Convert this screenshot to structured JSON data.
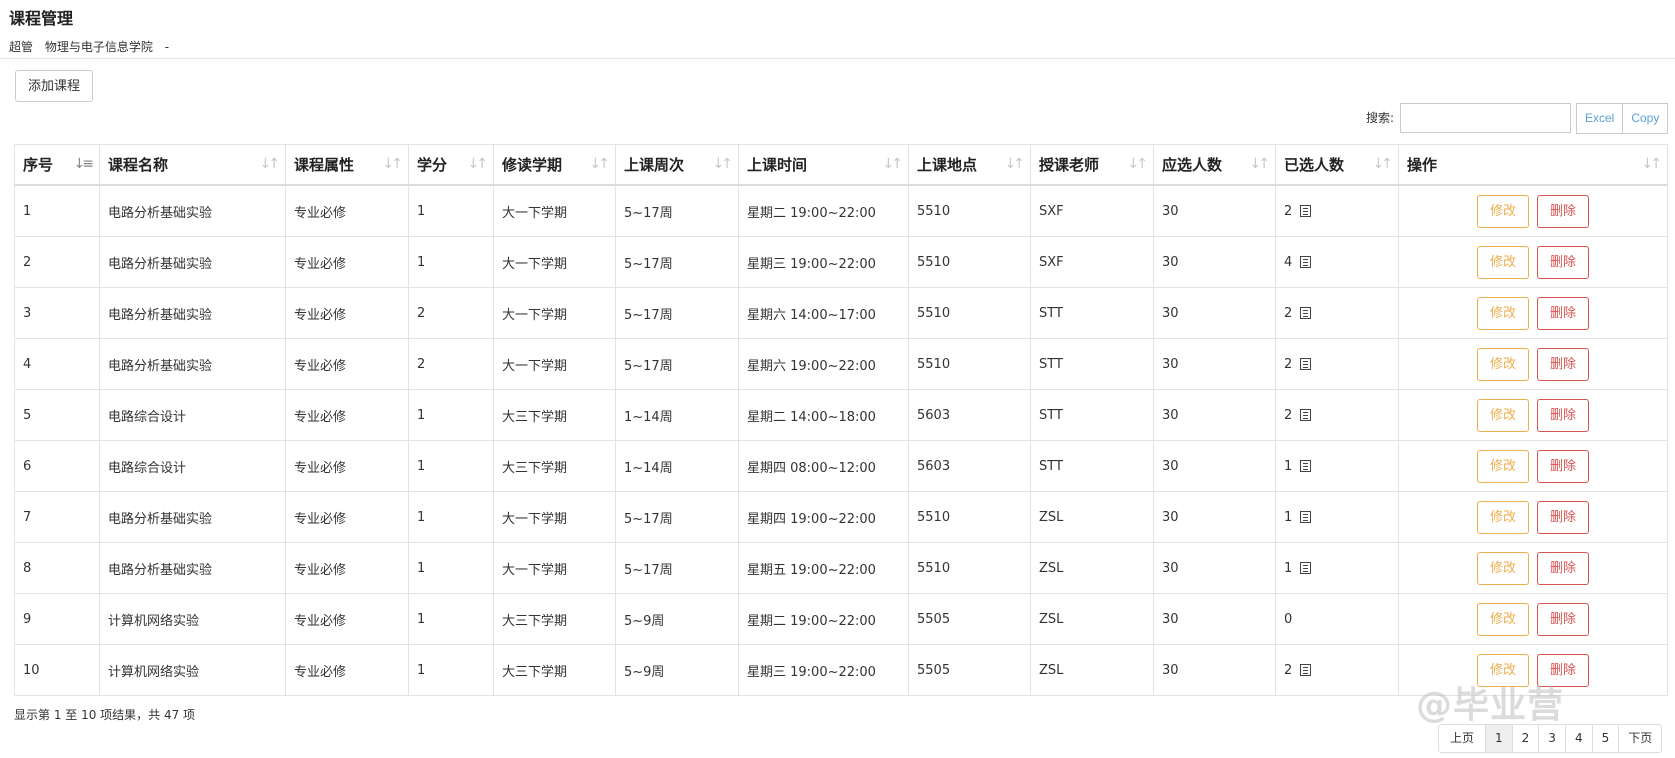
{
  "page": {
    "title": "课程管理",
    "user_role": "超管",
    "department": "物理与电子信息学院",
    "sep": "-"
  },
  "toolbar": {
    "add_course_label": "添加课程"
  },
  "search": {
    "label": "搜索:",
    "value": ""
  },
  "export": {
    "excel_label": "Excel",
    "copy_label": "Copy"
  },
  "table": {
    "columns": [
      "序号",
      "课程名称",
      "课程属性",
      "学分",
      "修读学期",
      "上课周次",
      "上课时间",
      "上课地点",
      "授课老师",
      "应选人数",
      "已选人数",
      "操作"
    ],
    "rows": [
      {
        "no": "1",
        "name": "电路分析基础实验",
        "type": "专业必修",
        "credit": "1",
        "term": "大一下学期",
        "weeks": "5~17周",
        "time": "星期二 19:00~22:00",
        "room": "5510",
        "teacher": "SXF",
        "cap": "30",
        "sel": "2",
        "has_list": true
      },
      {
        "no": "2",
        "name": "电路分析基础实验",
        "type": "专业必修",
        "credit": "1",
        "term": "大一下学期",
        "weeks": "5~17周",
        "time": "星期三 19:00~22:00",
        "room": "5510",
        "teacher": "SXF",
        "cap": "30",
        "sel": "4",
        "has_list": true
      },
      {
        "no": "3",
        "name": "电路分析基础实验",
        "type": "专业必修",
        "credit": "2",
        "term": "大一下学期",
        "weeks": "5~17周",
        "time": "星期六 14:00~17:00",
        "room": "5510",
        "teacher": "STT",
        "cap": "30",
        "sel": "2",
        "has_list": true
      },
      {
        "no": "4",
        "name": "电路分析基础实验",
        "type": "专业必修",
        "credit": "2",
        "term": "大一下学期",
        "weeks": "5~17周",
        "time": "星期六 19:00~22:00",
        "room": "5510",
        "teacher": "STT",
        "cap": "30",
        "sel": "2",
        "has_list": true
      },
      {
        "no": "5",
        "name": "电路综合设计",
        "type": "专业必修",
        "credit": "1",
        "term": "大三下学期",
        "weeks": "1~14周",
        "time": "星期二 14:00~18:00",
        "room": "5603",
        "teacher": "STT",
        "cap": "30",
        "sel": "2",
        "has_list": true
      },
      {
        "no": "6",
        "name": "电路综合设计",
        "type": "专业必修",
        "credit": "1",
        "term": "大三下学期",
        "weeks": "1~14周",
        "time": "星期四 08:00~12:00",
        "room": "5603",
        "teacher": "STT",
        "cap": "30",
        "sel": "1",
        "has_list": true
      },
      {
        "no": "7",
        "name": "电路分析基础实验",
        "type": "专业必修",
        "credit": "1",
        "term": "大一下学期",
        "weeks": "5~17周",
        "time": "星期四 19:00~22:00",
        "room": "5510",
        "teacher": "ZSL",
        "cap": "30",
        "sel": "1",
        "has_list": true
      },
      {
        "no": "8",
        "name": "电路分析基础实验",
        "type": "专业必修",
        "credit": "1",
        "term": "大一下学期",
        "weeks": "5~17周",
        "time": "星期五 19:00~22:00",
        "room": "5510",
        "teacher": "ZSL",
        "cap": "30",
        "sel": "1",
        "has_list": true
      },
      {
        "no": "9",
        "name": "计算机网络实验",
        "type": "专业必修",
        "credit": "1",
        "term": "大三下学期",
        "weeks": "5~9周",
        "time": "星期二 19:00~22:00",
        "room": "5505",
        "teacher": "ZSL",
        "cap": "30",
        "sel": "0",
        "has_list": false
      },
      {
        "no": "10",
        "name": "计算机网络实验",
        "type": "专业必修",
        "credit": "1",
        "term": "大三下学期",
        "weeks": "5~9周",
        "time": "星期三 19:00~22:00",
        "room": "5505",
        "teacher": "ZSL",
        "cap": "30",
        "sel": "2",
        "has_list": true
      }
    ],
    "edit_label": "修改",
    "delete_label": "删除"
  },
  "footer": {
    "info": "显示第 1 至 10 项结果，共 47 项"
  },
  "pagination": {
    "prev": "上页",
    "pages": [
      "1",
      "2",
      "3",
      "4",
      "5"
    ],
    "current": "1",
    "next": "下页"
  },
  "watermark": "@毕业营",
  "colors": {
    "edit": "#f0ad4e",
    "delete": "#d9534f",
    "link": "#5aa0d6"
  }
}
